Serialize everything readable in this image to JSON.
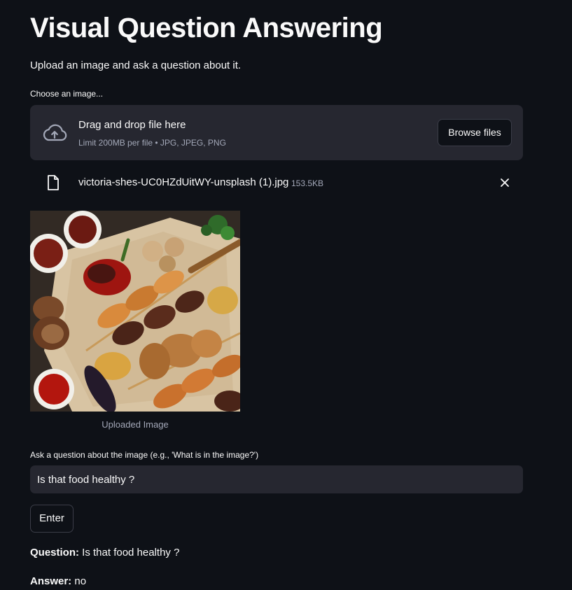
{
  "app": {
    "title": "Visual Question Answering",
    "subtitle": "Upload an image and ask a question about it."
  },
  "uploader": {
    "label": "Choose an image...",
    "drag_text": "Drag and drop file here",
    "limit_text": "Limit 200MB per file • JPG, JPEG, PNG",
    "browse_label": "Browse files",
    "icon": "cloud-upload-icon"
  },
  "file": {
    "name": "victoria-shes-UC0HZdUitWY-unsplash (1).jpg",
    "size": "153.5KB",
    "icon": "file-icon",
    "remove_icon": "close-icon"
  },
  "image": {
    "caption": "Uploaded Image",
    "subject": "grilled meat skewers, vegetables and sauces on flatbread"
  },
  "question": {
    "label": "Ask a question about the image (e.g., 'What is in the image?')",
    "value": "Is that food healthy ?"
  },
  "submit": {
    "label": "Enter"
  },
  "result": {
    "question_label": "Question:",
    "question_text": "Is that food healthy ?",
    "answer_label": "Answer:",
    "answer_text": "no"
  },
  "colors": {
    "background": "#0e1117",
    "surface": "#262730",
    "text": "#fafafa",
    "muted": "#a3a8b8"
  }
}
